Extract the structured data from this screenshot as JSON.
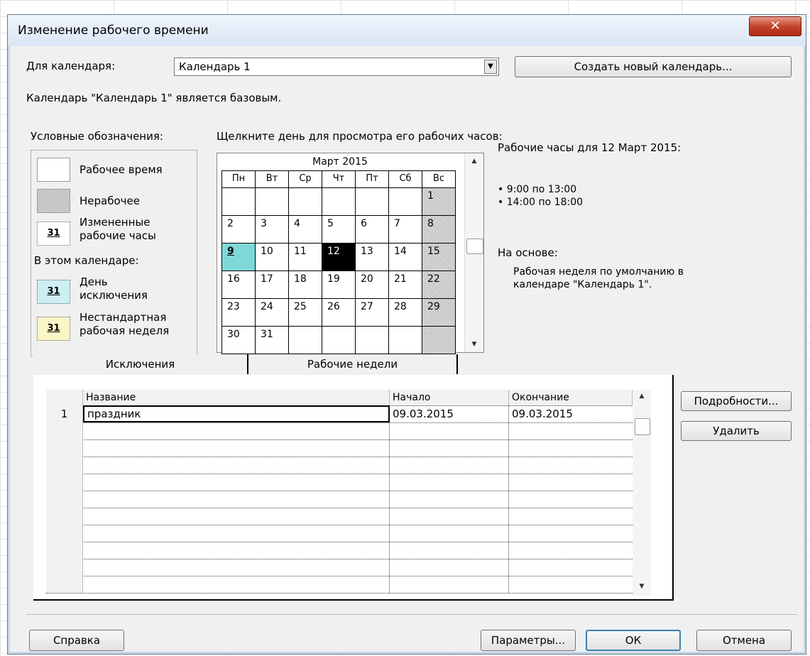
{
  "window": {
    "title": "Изменение рабочего времени",
    "close_icon": "✕"
  },
  "calendar_select": {
    "label": "Для календаря:",
    "value": "Календарь 1",
    "new_button": "Создать новый календарь..."
  },
  "info_text": "Календарь \"Календарь 1\" является базовым.",
  "legend": {
    "title": "Условные обозначения:",
    "working": "Рабочее время",
    "nonworking": "Нерабочее",
    "changed": [
      "Измененные",
      "рабочие часы"
    ],
    "in_calendar_title": "В этом календаре:",
    "exception": [
      "День",
      "исключения"
    ],
    "nondefault": [
      "Нестандартная",
      "рабочая неделя"
    ],
    "sample_day": "31"
  },
  "calendar_hint": "Щелкните день для просмотра его рабочих часов:",
  "calendar": {
    "month": "Март 2015",
    "weekdays": [
      "Пн",
      "Вт",
      "Ср",
      "Чт",
      "Пт",
      "Сб",
      "Вс"
    ],
    "weeks": [
      [
        "",
        "",
        "",
        "",
        "",
        "",
        "1"
      ],
      [
        "2",
        "3",
        "4",
        "5",
        "6",
        "7",
        "8"
      ],
      [
        "9",
        "10",
        "11",
        "12",
        "13",
        "14",
        "15"
      ],
      [
        "16",
        "17",
        "18",
        "19",
        "20",
        "21",
        "22"
      ],
      [
        "23",
        "24",
        "25",
        "26",
        "27",
        "28",
        "29"
      ],
      [
        "30",
        "31",
        "",
        "",
        "",
        "",
        ""
      ]
    ],
    "selected_day": "12",
    "exception_day": "9"
  },
  "work_hours": {
    "title": "Рабочие часы для 12 Март 2015:",
    "ranges": [
      "9:00 по 13:00",
      "14:00 по 18:00"
    ],
    "based_on_title": "На основе:",
    "based_on_text": [
      "Рабочая неделя по умолчанию в",
      "календаре \"Календарь 1\"."
    ]
  },
  "tabs": {
    "exceptions": "Исключения",
    "work_weeks": "Рабочие недели"
  },
  "table": {
    "columns": [
      "Название",
      "Начало",
      "Окончание"
    ],
    "rows": [
      {
        "num": "1",
        "name": "праздник",
        "start": "09.03.2015",
        "end": "09.03.2015"
      }
    ]
  },
  "side_buttons": {
    "details": "Подробности...",
    "delete": "Удалить"
  },
  "footer": {
    "help": "Справка",
    "options": "Параметры...",
    "ok": "ОК",
    "cancel": "Отмена"
  }
}
